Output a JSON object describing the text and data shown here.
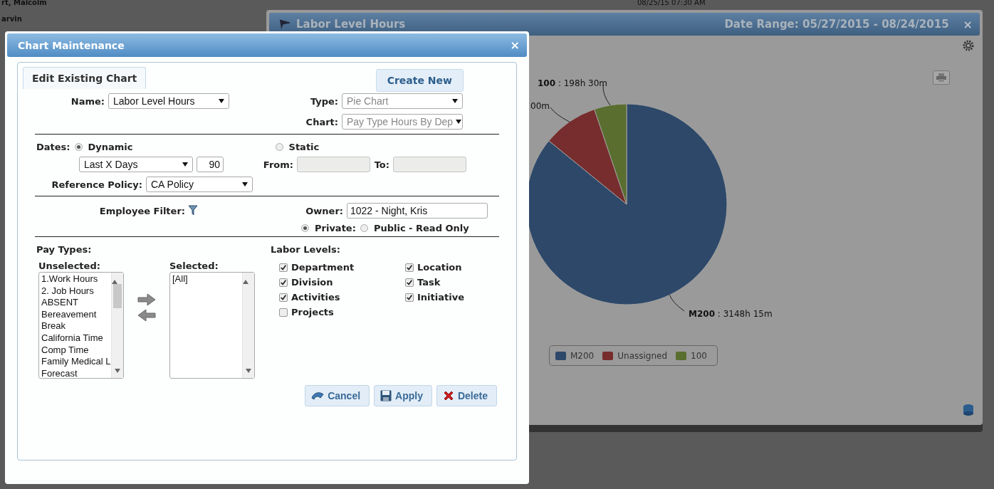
{
  "background_table": {
    "rows": [
      {
        "column_1": "rt, Malcolm",
        "column_2": "08/25/15 07:30 AM"
      },
      {
        "column_1": "arvin",
        "column_2": ""
      }
    ]
  },
  "chart_window": {
    "title": "Labor Level Hours",
    "date_range": "Date Range: 05/27/2015 - 08/24/2015",
    "close": "×",
    "chart_data": {
      "type": "pie",
      "categories": [
        "M200",
        "Unassigned",
        "100"
      ],
      "values": [
        85.9,
        8.9,
        5.2
      ],
      "colors": [
        "#2d4869",
        "#772d2d",
        "#5a6e2f"
      ],
      "annotations": [
        {
          "text": "**M200** : 3148h 15m"
        },
        {
          "text": "00m"
        },
        {
          "text": "**100** : 198h 30m"
        }
      ]
    }
  },
  "dialog": {
    "title": "Chart Maintenance",
    "close": "×",
    "tabs": [
      {
        "label": "Edit Existing Chart",
        "selected": true
      }
    ],
    "create_button": "Create New",
    "name": {
      "label": "Name:",
      "value": "Labor Level Hours",
      "disabled": false
    },
    "type": {
      "label": "Type:",
      "value": "Pie Chart",
      "disabled": true
    },
    "chart": {
      "label": "Chart:",
      "value": "Pay Type Hours By Dep",
      "disabled": true
    },
    "dates": {
      "label": "Dates:",
      "options": [
        {
          "label": "Dynamic",
          "selected": true
        },
        {
          "label": "Static",
          "selected": false
        }
      ],
      "range": "Last X Days",
      "days": "90",
      "from": {
        "label": "From:",
        "disabled": true
      },
      "to": {
        "label": "To:",
        "disabled": true
      }
    },
    "reference_policy": {
      "label": "Reference Policy:",
      "value": "CA Policy"
    },
    "employee_filter": {
      "label": "Employee Filter:"
    },
    "owner": {
      "label": "Owner:",
      "value": "1022 - Night, Kris"
    },
    "visibility": [
      {
        "label": "Private:",
        "selected": true
      },
      {
        "label": "Public - Read Only",
        "selected": false
      }
    ],
    "pay_types": {
      "label": "Pay Types:",
      "unselected_label": "Unselected:",
      "unselected": [
        "1.Work Hours",
        "2. Job Hours",
        "ABSENT",
        "Bereavement",
        "Break",
        "California Time",
        "Comp Time",
        "Family Medical L",
        "Forecast"
      ],
      "selected_label": "Selected:",
      "selected": [
        "[All]"
      ]
    },
    "labor_levels": {
      "label": "Labor Levels:",
      "items": [
        {
          "label": "Department",
          "checked": true
        },
        {
          "label": "Location",
          "checked": true
        },
        {
          "label": "Division",
          "checked": true
        },
        {
          "label": "Task",
          "checked": true
        },
        {
          "label": "Activities",
          "checked": true
        },
        {
          "label": "Initiative",
          "checked": true
        },
        {
          "label": "Projects",
          "checked": false
        }
      ]
    },
    "buttons": [
      {
        "label": "Cancel",
        "kind": "cancel"
      },
      {
        "label": "Apply",
        "kind": "apply"
      },
      {
        "label": "Delete",
        "kind": "delete"
      }
    ]
  }
}
